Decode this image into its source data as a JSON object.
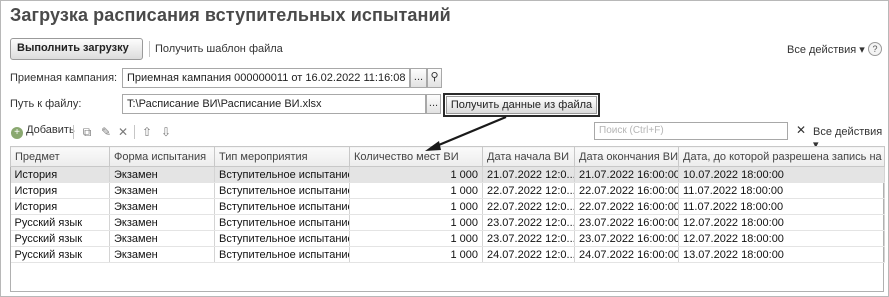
{
  "window": {
    "title": "Загрузка расписания вступительных испытаний"
  },
  "toolbar": {
    "run_label": "Выполнить загрузку",
    "template_label": "Получить шаблон файла",
    "all_actions_label": "Все действия ▾",
    "help_label": "?"
  },
  "form": {
    "campaign_label": "Приемная кампания:",
    "campaign_value": "Приемная кампания 000000011 от 16.02.2022 11:16:08",
    "path_label": "Путь к файлу:",
    "path_value": "T:\\Расписание ВИ\\Расписание ВИ.xlsx",
    "get_data_label": "Получить данные из файла"
  },
  "table_toolbar": {
    "add_label": "Добавить",
    "search_placeholder": "Поиск (Ctrl+F)",
    "all_actions_label": "Все действия ▾"
  },
  "table": {
    "columns": [
      "Предмет",
      "Форма испытания",
      "Тип мероприятия",
      "Количество мест ВИ",
      "Дата начала ВИ",
      "Дата окончания ВИ",
      "Дата, до которой разрешена запись на ВИ"
    ],
    "rows": [
      [
        "История",
        "Экзамен",
        "Вступительное испытание",
        "1 000",
        "21.07.2022 12:0...",
        "21.07.2022 16:00:00",
        "10.07.2022 18:00:00"
      ],
      [
        "История",
        "Экзамен",
        "Вступительное испытание",
        "1 000",
        "22.07.2022 12:0...",
        "22.07.2022 16:00:00",
        "11.07.2022 18:00:00"
      ],
      [
        "История",
        "Экзамен",
        "Вступительное испытание",
        "1 000",
        "22.07.2022 12:0...",
        "22.07.2022 16:00:00",
        "11.07.2022 18:00:00"
      ],
      [
        "Русский язык",
        "Экзамен",
        "Вступительное испытание",
        "1 000",
        "23.07.2022 12:0...",
        "23.07.2022 16:00:00",
        "12.07.2022 18:00:00"
      ],
      [
        "Русский язык",
        "Экзамен",
        "Вступительное испытание",
        "1 000",
        "23.07.2022 12:0...",
        "23.07.2022 16:00:00",
        "12.07.2022 18:00:00"
      ],
      [
        "Русский язык",
        "Экзамен",
        "Вступительное испытание",
        "1 000",
        "24.07.2022 12:0...",
        "24.07.2022 16:00:00",
        "13.07.2022 18:00:00"
      ]
    ]
  }
}
